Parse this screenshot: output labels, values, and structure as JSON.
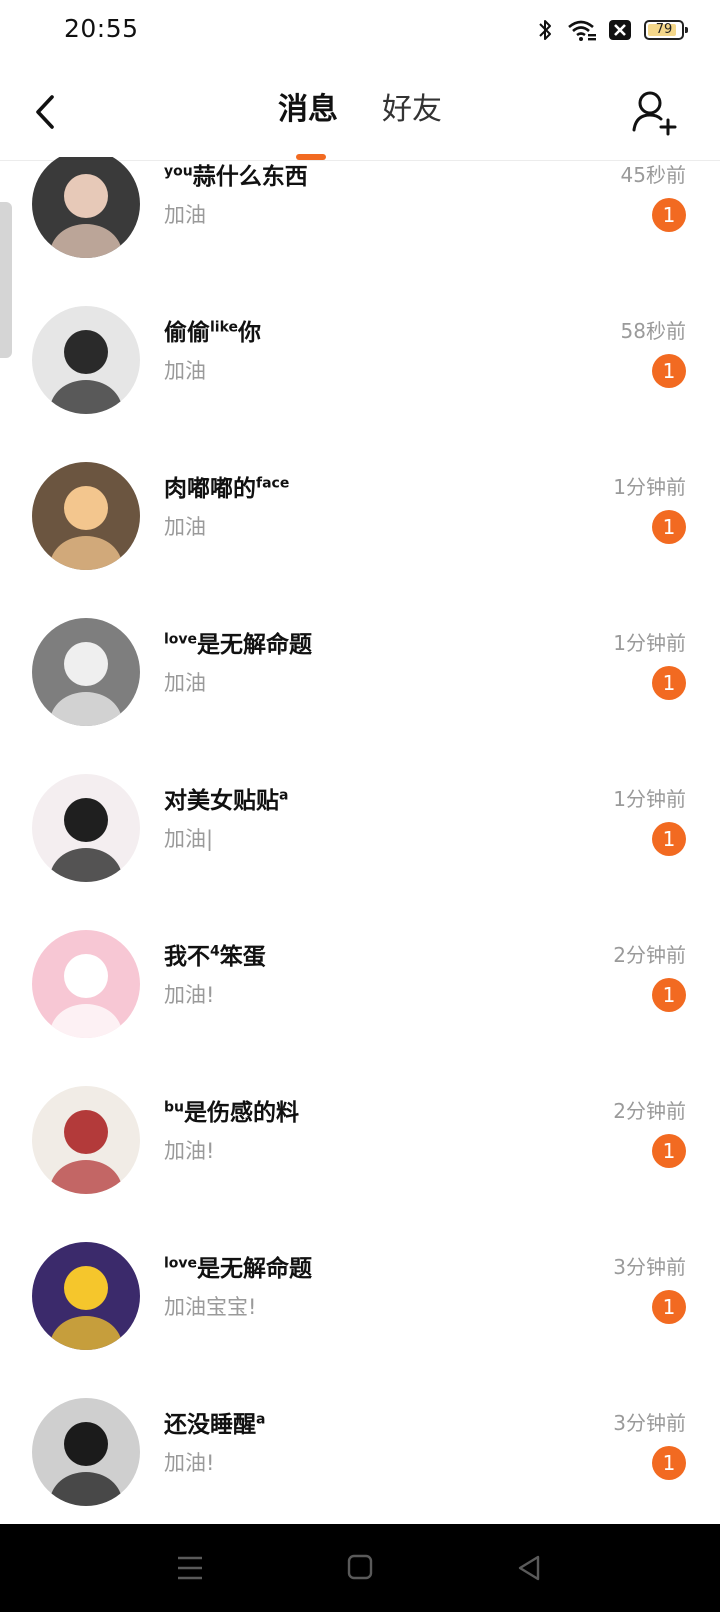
{
  "status_bar": {
    "time": "20:55",
    "battery": "79"
  },
  "header": {
    "tabs": [
      {
        "label": "消息",
        "active": true
      },
      {
        "label": "好友",
        "active": false
      }
    ]
  },
  "colors": {
    "accent": "#f26a21",
    "badge": "#f26a21",
    "muted_text": "#9a9a9a"
  },
  "messages": [
    {
      "name": "蒜什么东西",
      "name_sup": "you",
      "sup_pos": "before",
      "preview": "加油",
      "time": "45秒前",
      "unread": "1",
      "avatar_bg": "#3a3a3a",
      "avatar_fg": "#e7c9b8"
    },
    {
      "name": "偷偷",
      "name_sup": "like",
      "name_after": "你",
      "sup_pos": "middle",
      "preview": "加油",
      "time": "58秒前",
      "unread": "1",
      "avatar_bg": "#e6e6e6",
      "avatar_fg": "#2a2a2a"
    },
    {
      "name": "肉嘟嘟的",
      "name_sup": "face",
      "sup_pos": "after",
      "preview": "加油",
      "time": "1分钟前",
      "unread": "1",
      "avatar_bg": "#6b5540",
      "avatar_fg": "#f3c68e"
    },
    {
      "name": "是无解命题",
      "name_sup": "love",
      "sup_pos": "before",
      "preview": "加油",
      "time": "1分钟前",
      "unread": "1",
      "avatar_bg": "#7e7e7e",
      "avatar_fg": "#efefef"
    },
    {
      "name": "对美女贴贴",
      "name_sup": "a",
      "sup_pos": "after",
      "preview": "加油|",
      "time": "1分钟前",
      "unread": "1",
      "avatar_bg": "#f4eef0",
      "avatar_fg": "#1f1f1f"
    },
    {
      "name": "我不",
      "name_sup": "4",
      "name_after": "笨蛋",
      "sup_pos": "middle",
      "preview": "加油!",
      "time": "2分钟前",
      "unread": "1",
      "avatar_bg": "#f7c7d4",
      "avatar_fg": "#ffffff"
    },
    {
      "name": "是伤感的料",
      "name_sup": "bu",
      "sup_pos": "before",
      "preview": "加油!",
      "time": "2分钟前",
      "unread": "1",
      "avatar_bg": "#f1ece6",
      "avatar_fg": "#b33a3a"
    },
    {
      "name": "是无解命题",
      "name_sup": "love",
      "sup_pos": "before",
      "preview": "加油宝宝!",
      "time": "3分钟前",
      "unread": "1",
      "avatar_bg": "#3b2a6b",
      "avatar_fg": "#f5c62c"
    },
    {
      "name": "还没睡醒",
      "name_sup": "a",
      "sup_pos": "after",
      "preview": "加油!",
      "time": "3分钟前",
      "unread": "1",
      "avatar_bg": "#cfcfcf",
      "avatar_fg": "#1b1b1b"
    }
  ]
}
